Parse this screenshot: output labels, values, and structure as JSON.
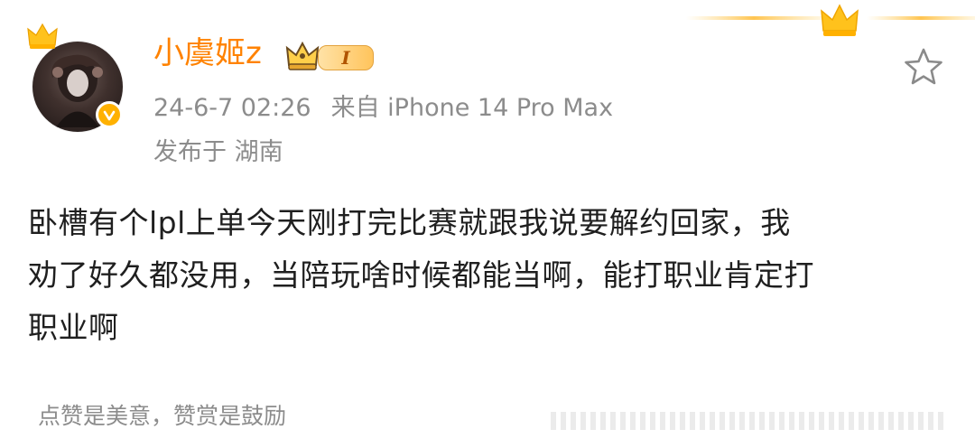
{
  "post": {
    "username": "小虞姬z",
    "member_level": "I",
    "timestamp": "24-6-7 02:26",
    "source": "来自 iPhone 14 Pro Max",
    "location": "发布于 湖南",
    "body_line_1": "卧槽有个lpl上单今天刚打完比赛就跟我说要解约回家，我",
    "body_line_2": "劝了好久都没用，当陪玩啥时候都能当啊，能打职业肯定打",
    "body_line_3": "职业啊",
    "footer": "点赞是美意，赞赏是鼓励"
  },
  "colors": {
    "username": "#ff8200",
    "meta": "#8c8c8c",
    "badge_gold": "#ffb100"
  },
  "icons": {
    "crown": "crown-icon",
    "verified": "verified-icon",
    "member": "member-icon",
    "favorite": "star-icon"
  }
}
